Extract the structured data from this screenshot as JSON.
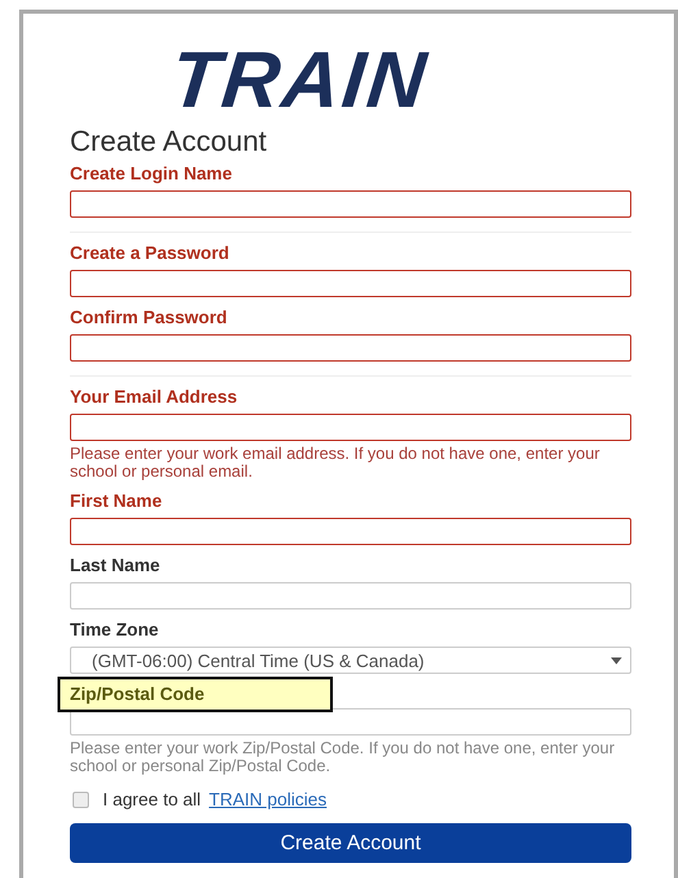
{
  "logo": {
    "text": "TRAIN"
  },
  "heading": "Create Account",
  "sections": [
    {
      "fields": [
        {
          "label": "Create Login Name",
          "kind": "text",
          "invalid": true,
          "highlighted": false
        }
      ]
    },
    {
      "fields": [
        {
          "label": "Create a Password",
          "kind": "text",
          "invalid": true,
          "highlighted": false
        },
        {
          "label": "Confirm Password",
          "kind": "text",
          "invalid": true,
          "highlighted": false
        }
      ]
    },
    {
      "fields": [
        {
          "label": "Your Email Address",
          "kind": "text",
          "invalid": true,
          "highlighted": false,
          "help": "Please enter your work email address. If you do not have one, enter your school or personal email."
        },
        {
          "label": "First Name",
          "kind": "text",
          "invalid": true,
          "highlighted": false
        },
        {
          "label": "Last Name",
          "kind": "text",
          "invalid": false,
          "highlighted": false
        },
        {
          "label": "Time Zone",
          "kind": "select",
          "invalid": false,
          "highlighted": false,
          "value": "(GMT-06:00) Central Time (US & Canada)"
        },
        {
          "label": "Zip/Postal Code",
          "kind": "text",
          "invalid": false,
          "highlighted": true,
          "help": "Please enter your work Zip/Postal Code. If you do not have one, enter your school or personal Zip/Postal Code."
        }
      ]
    }
  ],
  "agree": {
    "checked": false,
    "text": "I agree to all",
    "link": "TRAIN policies"
  },
  "submit": "Create Account"
}
